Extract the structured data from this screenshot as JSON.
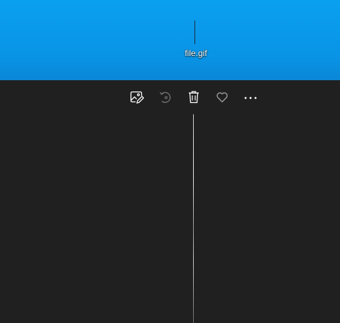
{
  "desktop": {
    "file_icon": {
      "label": "file.gif",
      "icon": "gif-file-thumbnail"
    },
    "background_color": "#0a9ce8"
  },
  "viewer": {
    "background_color": "#202020",
    "toolbar": {
      "edit": {
        "icon": "edit-image-icon"
      },
      "rotate": {
        "icon": "rotate-icon"
      },
      "delete": {
        "icon": "trash-icon"
      },
      "favorite": {
        "icon": "heart-icon"
      },
      "more": {
        "icon": "more-options-icon"
      }
    },
    "image": {
      "icon": "thin-vertical-gif-image"
    }
  }
}
